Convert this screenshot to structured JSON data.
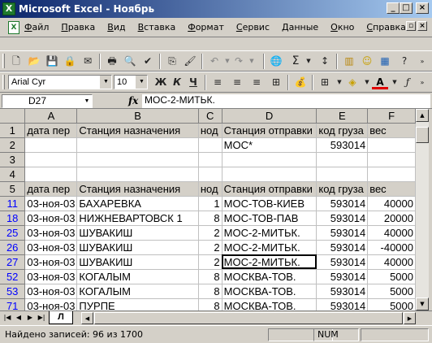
{
  "window": {
    "title": "Microsoft Excel - Ноябрь",
    "app_icon": "excel-icon"
  },
  "menu": [
    "Файл",
    "Правка",
    "Вид",
    "Вставка",
    "Формат",
    "Сервис",
    "Данные",
    "Окно",
    "Справка"
  ],
  "format": {
    "font": "Arial Cyr",
    "size": "10",
    "bold": "Ж",
    "italic": "К",
    "underline": "Ч"
  },
  "formula_bar": {
    "cell": "D27",
    "fx": "fx",
    "value": "МОС-2-МИТЬК."
  },
  "grid": {
    "columns": [
      "A",
      "B",
      "C",
      "D",
      "E",
      "F"
    ],
    "rows": [
      {
        "row": "1",
        "cells": [
          "дата пер",
          "Станция назначения",
          "нод",
          "Станция отправки",
          "код груза",
          "вес"
        ],
        "header": true,
        "blue": false
      },
      {
        "row": "2",
        "cells": [
          "",
          "",
          "",
          "МОС*",
          "593014",
          ""
        ],
        "header": false,
        "blue": false
      },
      {
        "row": "3",
        "cells": [
          "",
          "",
          "",
          "",
          "",
          ""
        ],
        "header": false,
        "blue": false
      },
      {
        "row": "4",
        "cells": [
          "",
          "",
          "",
          "",
          "",
          ""
        ],
        "header": false,
        "blue": false
      },
      {
        "row": "5",
        "cells": [
          "дата пер",
          "Станция назначения",
          "нод",
          "Станция отправки",
          "код груза",
          "вес"
        ],
        "header": true,
        "blue": false
      },
      {
        "row": "11",
        "cells": [
          "03-ноя-03",
          "БАХАРЕВКА",
          "1",
          "МОС-ТОВ-КИЕВ",
          "593014",
          "40000"
        ],
        "header": false,
        "blue": true
      },
      {
        "row": "18",
        "cells": [
          "03-ноя-03",
          "НИЖНЕВАРТОВСК 1",
          "8",
          "МОС-ТОВ-ПАВ",
          "593014",
          "20000"
        ],
        "header": false,
        "blue": true
      },
      {
        "row": "25",
        "cells": [
          "03-ноя-03",
          "ШУВАКИШ",
          "2",
          "МОС-2-МИТЬК.",
          "593014",
          "40000"
        ],
        "header": false,
        "blue": true
      },
      {
        "row": "26",
        "cells": [
          "03-ноя-03",
          "ШУВАКИШ",
          "2",
          "МОС-2-МИТЬК.",
          "593014",
          "-40000"
        ],
        "header": false,
        "blue": true
      },
      {
        "row": "27",
        "cells": [
          "03-ноя-03",
          "ШУВАКИШ",
          "2",
          "МОС-2-МИТЬК.",
          "593014",
          "40000"
        ],
        "header": false,
        "blue": true
      },
      {
        "row": "52",
        "cells": [
          "03-ноя-03",
          "КОГАЛЫМ",
          "8",
          "МОСКВА-ТОВ.",
          "593014",
          "5000"
        ],
        "header": false,
        "blue": true
      },
      {
        "row": "53",
        "cells": [
          "03-ноя-03",
          "КОГАЛЫМ",
          "8",
          "МОСКВА-ТОВ.",
          "593014",
          "5000"
        ],
        "header": false,
        "blue": true
      },
      {
        "row": "71",
        "cells": [
          "03-ноя-03",
          "ПУРПЕ",
          "8",
          "МОСКВА-ТОВ.",
          "593014",
          "5000"
        ],
        "header": false,
        "blue": true
      }
    ]
  },
  "sheet_tab": "Л",
  "status": {
    "text": "Найдено записей: 96 из 1700",
    "num": "NUM"
  },
  "colors": {
    "title_start": "#0a246a",
    "title_end": "#a6caf0",
    "face": "#d4d0c8",
    "filtered_row_number": "#0000ff"
  }
}
